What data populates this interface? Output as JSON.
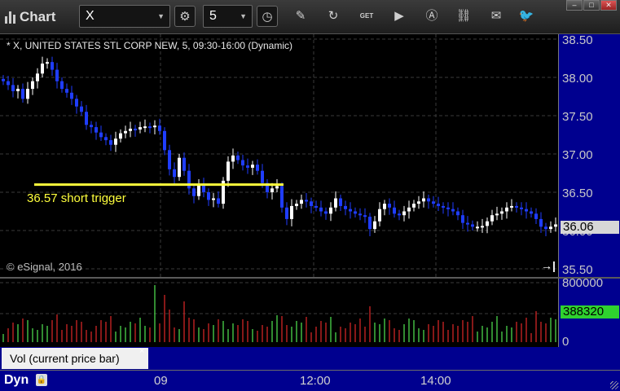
{
  "window": {
    "title": "Chart",
    "symbol": "X",
    "interval": "5",
    "buttons": [
      "minimize",
      "maximize",
      "close"
    ]
  },
  "toolbar": {
    "icons": [
      "symbol-settings-icon",
      "interval-clock-icon",
      "pencil-draw-icon",
      "refresh-cycle-icon",
      "get-data-icon",
      "play-icon",
      "alert-icon",
      "link-icon",
      "comment-icon",
      "twitter-icon"
    ],
    "get_label": "GET"
  },
  "chart": {
    "title": "* X, UNITED STATES STL CORP NEW, 5, 09:30-16:00 (Dynamic)",
    "copyright": "© eSignal, 2016",
    "price_axis": [
      "38.50",
      "38.00",
      "37.50",
      "37.00",
      "36.50",
      "36.00",
      "35.50"
    ],
    "last_price": "36.06",
    "annotation": {
      "text": "36.57 short trigger",
      "level": 36.6,
      "color": "#ffff3c"
    },
    "time_labels": [
      "09",
      "12:00",
      "14:00"
    ],
    "colors": {
      "up": "#ffffff",
      "down": "#1f3dff",
      "axis": "#00008f",
      "vol_up": "#4cd64c",
      "vol_down": "#d02525"
    }
  },
  "volume": {
    "axis_labels": [
      "800000",
      "0"
    ],
    "last_value": "388320",
    "study_label": "Vol (current price bar)",
    "close_symbol": "×"
  },
  "status": {
    "mode": "Dyn"
  }
}
